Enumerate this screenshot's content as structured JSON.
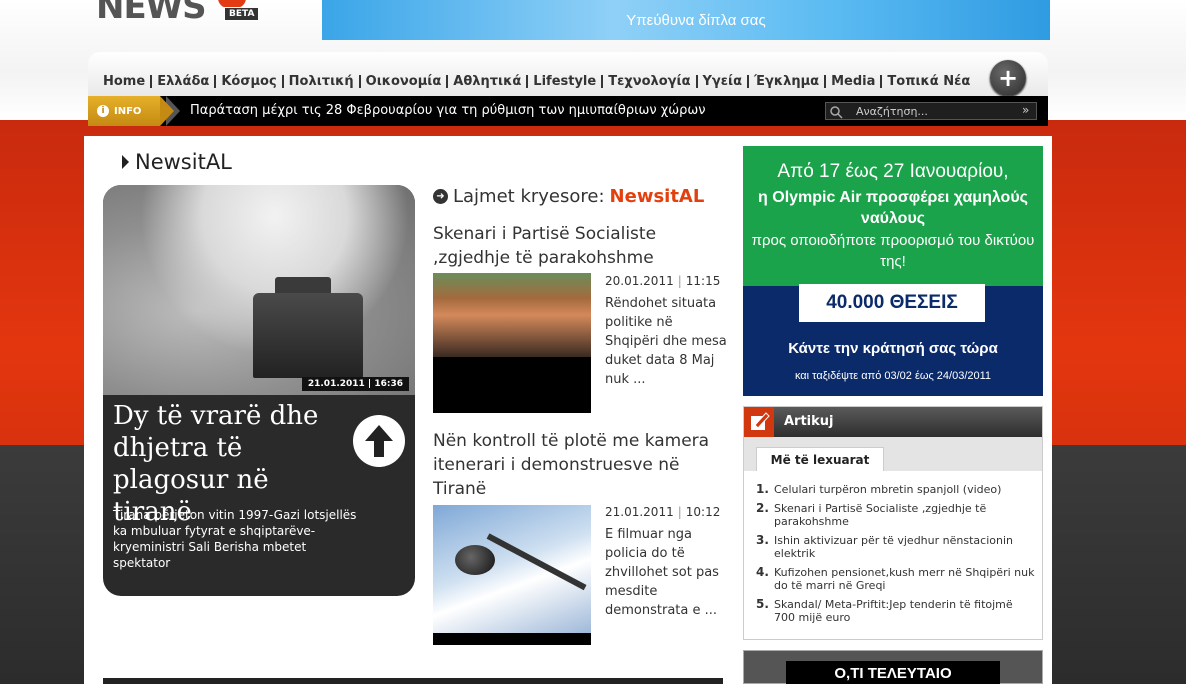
{
  "site": {
    "logo_text": "NEWS",
    "logo_badge": "BETA"
  },
  "top_ad": {
    "text": "Υπεύθυνα δίπλα σας"
  },
  "nav": {
    "items": [
      "Home",
      "Ελλάδα",
      "Κόσμος",
      "Πολιτική",
      "Οικονομία",
      "Αθλητικά",
      "Lifestyle",
      "Τεχνολογία",
      "Υγεία",
      "Έγκλημα",
      "Media",
      "Τοπικά Νέα"
    ],
    "plus_label": "+"
  },
  "ticker": {
    "badge": "INFO",
    "text": "Παράταση μέχρι τις 28 Φεβρουαρίου για τη ρύθμιση των ημιυπαίθριων χώρων"
  },
  "search": {
    "placeholder": "Αναζήτηση...",
    "go": "»"
  },
  "section": {
    "title": "NewsitAL"
  },
  "feature": {
    "date": "21.01.2011 | 16:36",
    "headline": "Dy të vrarë dhe dhjetra të plagosur në tiranë",
    "summary": "Tirana përjeton vitin 1997-Gazi lotsjellës ka mbuluar fytyrat e shqiptarëve-kryeministri Sali Berisha mbetet spektator"
  },
  "news": {
    "heading_prefix": "Lajmet kryesore:",
    "heading_accent": "NewsitAL",
    "articles": [
      {
        "title": "Skenari i Partisë Socialiste ,zgjedhje të parakohshme",
        "date": "20.01.2011",
        "time": "11:15",
        "excerpt": "Rëndohet situata politike në Shqipëri dhe mesa duket data 8 Maj nuk ..."
      },
      {
        "title": "Nën kontroll të plotë me kamera itenerari i demonstruesve në Tiranë",
        "date": "21.01.2011",
        "time": "10:12",
        "excerpt": "E filmuar nga policia do të zhvillohet sot pas mesdite demonstrata e ..."
      }
    ]
  },
  "ad_olympic": {
    "line1": "Από 17 έως 27 Ιανουαρίου,",
    "line2": "η Olympic Air προσφέρει χαμηλούς ναύλους",
    "line3": "προς οποιοδήποτε προορισμό του δικτύου της!",
    "seats": "40.000 ΘΕΣΕΙΣ",
    "cta": "Κάντε την κράτησή σας τώρα",
    "dates": "και ταξιδέψτε από 03/02 έως 24/03/2011"
  },
  "articles_box": {
    "title": "Artikuj",
    "tab": "Më të lexuarat",
    "items": [
      "Celulari turpëron mbretin spanjoll (video)",
      "Skenari i Partisë Socialiste ,zgjedhje të parakohshme",
      "Ishin aktivizuar për të vjedhur nënstacionin elektrik",
      "Kufizohen pensionet,kush merr në Shqipëri nuk do të marri në Greqi",
      "Skandal/ Meta-Priftit:Jep tenderin të fitojmë 700 mijë euro"
    ]
  },
  "ad_bottom": {
    "text": "Ο,ΤΙ ΤΕΛΕΥΤΑΙΟ"
  },
  "colors": {
    "accent": "#e3400f",
    "header_red": "#d8320e",
    "ticker_bg": "#000000",
    "info_gold": "#d49a1c",
    "ad_green": "#1aa34a",
    "ad_navy": "#0b2a6a"
  }
}
